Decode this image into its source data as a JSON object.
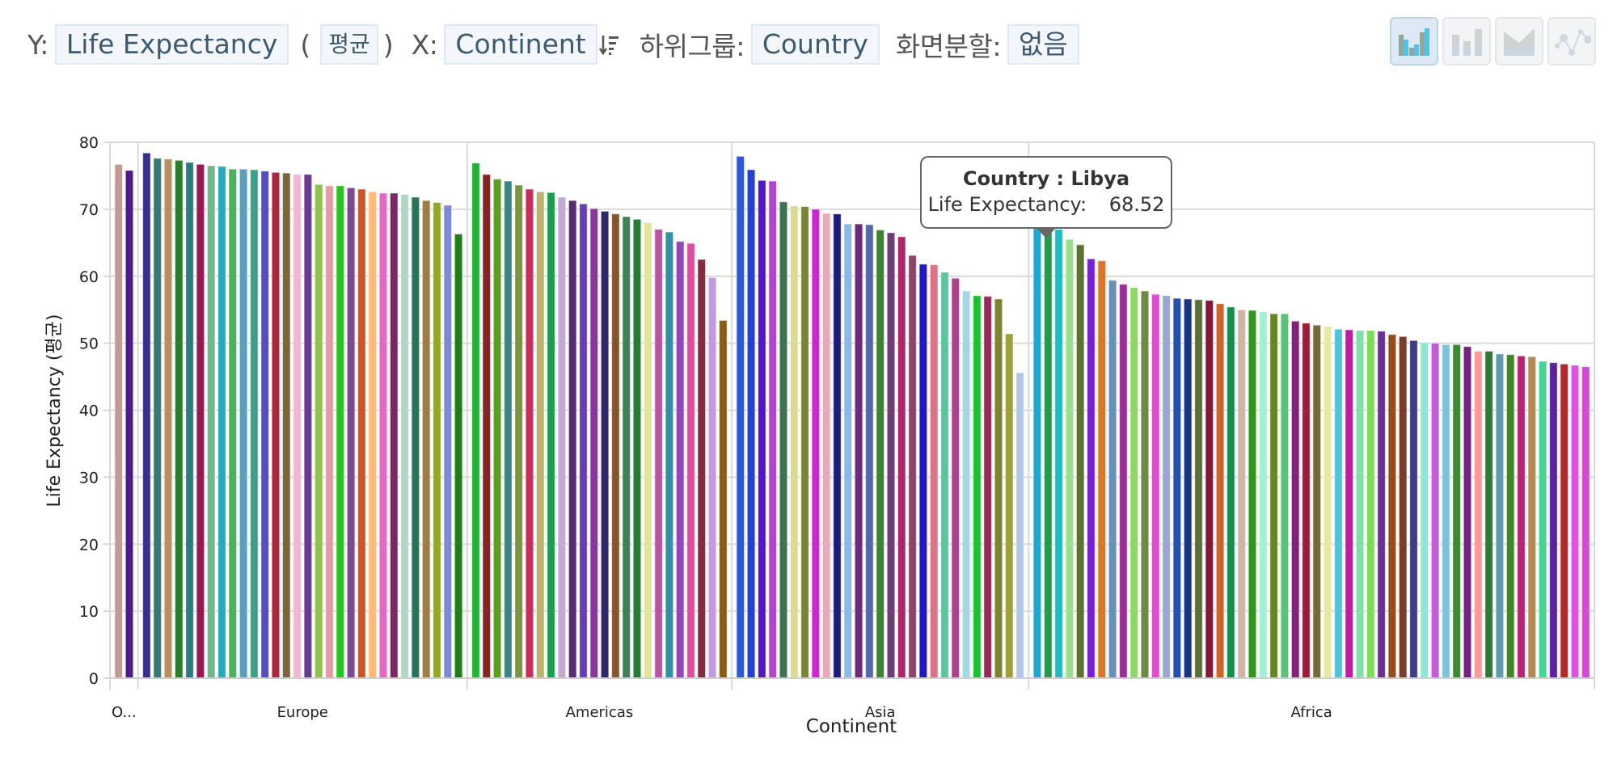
{
  "toolbar": {
    "y_label": "Y:",
    "y_field": "Life Expectancy",
    "open_paren": "(",
    "aggregation": "평균",
    "close_paren": ")",
    "x_label": "X:",
    "x_field": "Continent",
    "subgroup_label": "하위그룹:",
    "subgroup_field": "Country",
    "split_label": "화면분할:",
    "split_value": "없음",
    "chart_types": [
      {
        "name": "grouped-bar",
        "active": true
      },
      {
        "name": "stacked-bar",
        "active": false
      },
      {
        "name": "area",
        "active": false
      },
      {
        "name": "scatter-line",
        "active": false
      }
    ]
  },
  "tooltip": {
    "title": "Country : Libya",
    "metric_label": "Life Expectancy:",
    "metric_value": "68.52"
  },
  "chart_data": {
    "type": "bar",
    "title": "",
    "xlabel": "Continent",
    "ylabel": "Life Expectancy (평균)",
    "ylim": [
      0,
      80
    ],
    "yticks": [
      0,
      10,
      20,
      30,
      40,
      50,
      60,
      70,
      80
    ],
    "grid": true,
    "legend": "none",
    "highlighted": {
      "group": "Africa",
      "country": "Libya",
      "value": 68.52
    },
    "groups": [
      {
        "label": "O...",
        "values": [
          76.7,
          75.8
        ],
        "colors": [
          "#c49a94",
          "#4d1a8a"
        ]
      },
      {
        "label": "Europe",
        "values": [
          78.4,
          77.6,
          77.5,
          77.3,
          77.0,
          76.7,
          76.5,
          76.4,
          76.0,
          76.0,
          75.9,
          75.7,
          75.5,
          75.4,
          75.2,
          75.2,
          73.7,
          73.5,
          73.5,
          73.2,
          73.0,
          72.6,
          72.4,
          72.4,
          72.2,
          71.8,
          71.3,
          71.0,
          70.6,
          66.3
        ],
        "colors": [
          "#353090",
          "#357a70",
          "#b89060",
          "#268025",
          "#2a7c80",
          "#9a1558",
          "#72b888",
          "#24aac0",
          "#4fb05a",
          "#5aa0c0",
          "#3aa088",
          "#544cc2",
          "#b0243c",
          "#7a6838",
          "#f4b4d2",
          "#6a3a92",
          "#8ec44c",
          "#e898a6",
          "#22c81a",
          "#7a4a98",
          "#cc5526",
          "#ffba74",
          "#e468c4",
          "#7a2862",
          "#acd8c4",
          "#287458",
          "#a07c40",
          "#92a81e",
          "#7a8ad8",
          "#1e8014"
        ]
      },
      {
        "label": "Americas",
        "values": [
          76.9,
          75.2,
          74.5,
          74.2,
          73.6,
          73.0,
          72.6,
          72.5,
          71.8,
          71.3,
          70.8,
          70.1,
          69.7,
          69.3,
          68.9,
          68.5,
          68.0,
          67.0,
          66.6,
          65.2,
          64.9,
          62.5,
          59.8,
          53.4
        ],
        "colors": [
          "#1cb430",
          "#842424",
          "#5aa01c",
          "#388488",
          "#7a9440",
          "#cc2c5c",
          "#bab46c",
          "#18a04c",
          "#c2aad4",
          "#582c70",
          "#6440b4",
          "#8a369c",
          "#2e2870",
          "#885428",
          "#3e8058",
          "#267c34",
          "#e4e498",
          "#bc52a4",
          "#3090aa",
          "#9444bc",
          "#e04ca4",
          "#842c3c",
          "#c29ae4",
          "#8c5c10"
        ]
      },
      {
        "label": "Asia",
        "values": [
          77.9,
          75.9,
          74.3,
          74.2,
          71.1,
          70.5,
          70.4,
          70.0,
          69.4,
          69.3,
          67.8,
          67.8,
          67.7,
          66.9,
          66.5,
          65.9,
          63.1,
          61.8,
          61.7,
          60.6,
          59.7,
          57.8,
          57.1,
          57.0,
          56.6,
          51.4,
          45.6
        ],
        "colors": [
          "#2858e4",
          "#2040d8",
          "#5018c0",
          "#b444d0",
          "#3a7450",
          "#dadc94",
          "#7a8434",
          "#d024d4",
          "#e8aab4",
          "#1c1c80",
          "#8cb8e8",
          "#70287a",
          "#5468a8",
          "#3c8430",
          "#703c78",
          "#b0246c",
          "#8c4468",
          "#2018c4",
          "#e27084",
          "#58c89c",
          "#b0408c",
          "#a0d8e4",
          "#18c42c",
          "#982858",
          "#7c8430",
          "#a0a038",
          "#b0c8e8"
        ]
      },
      {
        "label": "Africa",
        "values": [
          68.52,
          68.0,
          67.0,
          65.5,
          64.7,
          62.6,
          62.3,
          59.4,
          58.8,
          58.3,
          57.8,
          57.3,
          57.1,
          56.7,
          56.6,
          56.5,
          56.4,
          55.9,
          55.4,
          55.0,
          54.9,
          54.7,
          54.4,
          54.4,
          53.3,
          53.0,
          52.7,
          52.5,
          52.1,
          52.0,
          51.9,
          51.9,
          51.8,
          51.3,
          51.0,
          50.4,
          50.1,
          50.0,
          49.8,
          49.8,
          49.5,
          48.8,
          48.8,
          48.4,
          48.3,
          48.1,
          48.0,
          47.3,
          47.1,
          46.9,
          46.7,
          46.5
        ],
        "colors": [
          "#1ca8d4",
          "#229a50",
          "#1cbcc4",
          "#98e08c",
          "#5a7430",
          "#7a1ce0",
          "#e07424",
          "#6890b8",
          "#a02c9c",
          "#8cd860",
          "#6a8c40",
          "#e848d8",
          "#98a8d0",
          "#2250b0",
          "#183484",
          "#5a7038",
          "#841838",
          "#d06424",
          "#109048",
          "#d0b4a4",
          "#309818",
          "#a0f0d8",
          "#64881c",
          "#58c474",
          "#86207c",
          "#9c1c38",
          "#7a6834",
          "#e8e8a0",
          "#4ec4dc",
          "#c01ca0",
          "#7ce0a8",
          "#78e050",
          "#6c3094",
          "#984c18",
          "#7c3c2c",
          "#3c3c88",
          "#8ce8d4",
          "#c858e0",
          "#78c4dc",
          "#388c30",
          "#742480",
          "#ff9898",
          "#307834",
          "#609cb0",
          "#408824",
          "#c02070",
          "#b48850",
          "#44d494",
          "#5c20a0",
          "#b42828",
          "#e050e8",
          "#d848d8"
        ]
      }
    ]
  }
}
